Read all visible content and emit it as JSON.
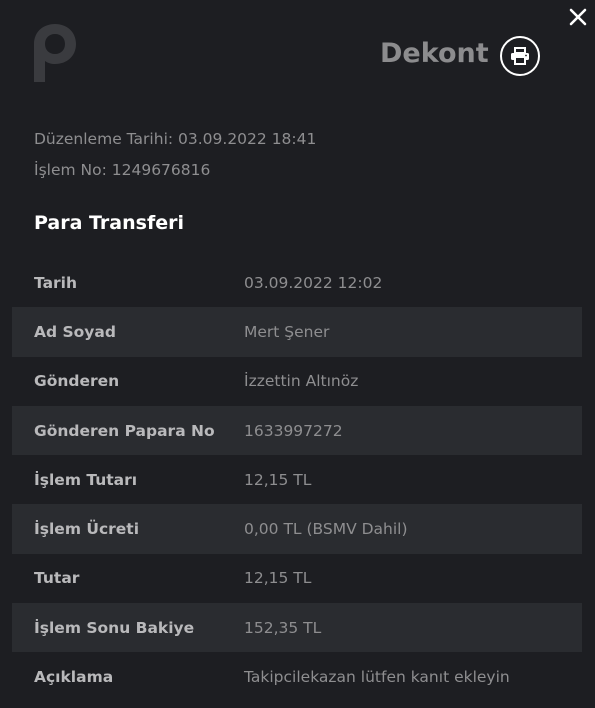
{
  "header": {
    "title": "Dekont"
  },
  "meta": {
    "date_line": "Düzenleme Tarihi: 03.09.2022 18:41",
    "tx_line": "İşlem No: 1249676816"
  },
  "section": {
    "title": "Para Transferi"
  },
  "details": [
    {
      "label": "Tarih",
      "value": "03.09.2022 12:02"
    },
    {
      "label": "Ad Soyad",
      "value": "Mert Şener"
    },
    {
      "label": "Gönderen",
      "value": "İzzettin Altınöz"
    },
    {
      "label": "Gönderen Papara No",
      "value": "1633997272"
    },
    {
      "label": "İşlem Tutarı",
      "value": "12,15 TL"
    },
    {
      "label": "İşlem Ücreti",
      "value": "0,00 TL (BSMV Dahil)"
    },
    {
      "label": "Tutar",
      "value": "12,15 TL"
    },
    {
      "label": "İşlem Sonu Bakiye",
      "value": "152,35 TL"
    },
    {
      "label": "Açıklama",
      "value": "Takipcilekazan lütfen kanıt ekleyin"
    }
  ],
  "icons": {
    "close": "close-icon",
    "print": "printer-icon",
    "logo": "papara-logo"
  },
  "colors": {
    "background": "#1d1e22",
    "row_shade": "#2a2c30",
    "title_gray": "#8c8c8e"
  }
}
